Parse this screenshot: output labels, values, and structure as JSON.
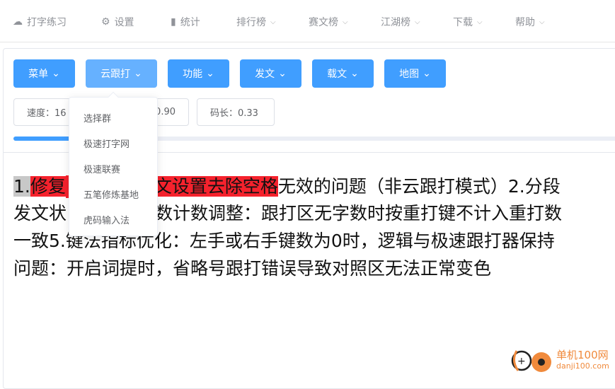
{
  "nav": [
    {
      "label": "打字练习",
      "icon": "cloud-icon"
    },
    {
      "label": "设置",
      "icon": "gear-icon"
    },
    {
      "label": "统计",
      "icon": "bar-chart-icon"
    },
    {
      "label": "排行榜"
    },
    {
      "label": "赛文榜"
    },
    {
      "label": "江湖榜"
    },
    {
      "label": "下载"
    },
    {
      "label": "帮助"
    }
  ],
  "toolbar": [
    "菜单",
    "云跟打",
    "功能",
    "发文",
    "载文",
    "地图"
  ],
  "stats": {
    "speed": "速度：16",
    "accuracy": "0.90",
    "code_length": "码长：0.33"
  },
  "progress": 0.1,
  "dropdown": [
    "选择群",
    "极速打字网",
    "极速联赛",
    "五笔修炼基地",
    "虎码输入法"
  ],
  "text": {
    "l1_typed": "1.",
    "l1_err1": "修复",
    "l1_err2": "文设置去除空格",
    "l1_rest": "无效的问题（非云跟打模式）2.分段",
    "l2_a": "发文状",
    "l2_b": "数计数调整：跟打区无字数时按重打键不计入重打数",
    "l3": "一致5.键法指标优化：左手或右手键数为0时，逻辑与极速跟打器保持",
    "l4": "问题：开启词提时，省略号跟打错误导致对照区无法正常变色"
  },
  "watermark": {
    "name": "单机100网",
    "url": "danji100.com"
  },
  "colors": {
    "primary": "#409eff",
    "error": "#f5222d",
    "watermark": "#f08a3c"
  }
}
